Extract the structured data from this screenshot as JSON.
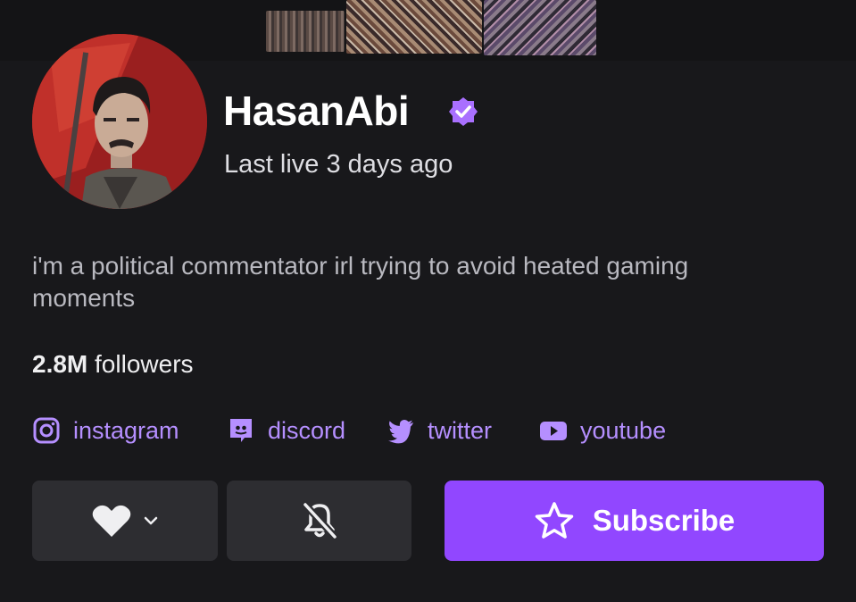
{
  "channel": {
    "name": "HasanAbi",
    "verified": true,
    "last_live": "Last live 3 days ago",
    "bio": "i'm a political commentator irl trying to avoid heated gaming moments",
    "followers_count": "2.8M",
    "followers_label": "followers"
  },
  "socials": [
    {
      "label": "instagram",
      "icon": "instagram-icon"
    },
    {
      "label": "discord",
      "icon": "discord-icon"
    },
    {
      "label": "twitter",
      "icon": "twitter-icon"
    },
    {
      "label": "youtube",
      "icon": "youtube-icon"
    }
  ],
  "actions": {
    "follow_icon": "heart-icon",
    "dropdown_icon": "chevron-down-icon",
    "notify_icon": "bell-off-icon",
    "subscribe_label": "Subscribe",
    "subscribe_icon": "star-icon"
  },
  "colors": {
    "background": "#18181b",
    "accent": "#9147ff",
    "link": "#b58fff",
    "button_bg": "#2d2d31"
  }
}
